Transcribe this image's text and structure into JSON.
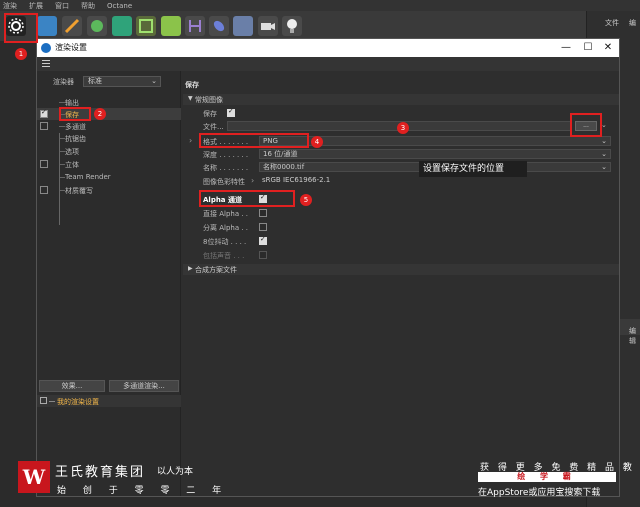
{
  "app_menu": [
    "渲染",
    "扩展",
    "窗口",
    "帮助",
    "Octane"
  ],
  "right_panel": {
    "file_label": "文件",
    "edit_label": "编",
    "edit_label2": "编辑"
  },
  "dialog": {
    "title": "渲染设置",
    "window_buttons": {
      "minimize": "—",
      "maximize": "☐",
      "close": "✕"
    }
  },
  "renderer": {
    "label": "渲染器",
    "value": "标准"
  },
  "tree_items": [
    {
      "label": "输出",
      "checkbox": "none"
    },
    {
      "label": "保存",
      "checkbox": "on",
      "active": true
    },
    {
      "label": "多通道",
      "checkbox": "off"
    },
    {
      "label": "抗锯齿",
      "checkbox": "none"
    },
    {
      "label": "选项",
      "checkbox": "none"
    },
    {
      "label": "立体",
      "checkbox": "off"
    },
    {
      "label": "Team Render",
      "checkbox": "none"
    },
    {
      "label": "材质覆写",
      "checkbox": "off"
    }
  ],
  "left_buttons": {
    "effects": "效果...",
    "multipass_render": "多通道渲染..."
  },
  "my_settings": "我的渲染设置",
  "main": {
    "section_title": "保存",
    "group_general": "常规图像",
    "save_label": "保存",
    "file_label": "文件...",
    "browse_label": "...",
    "format_label": "格式 . . . . . . .",
    "format_value": "PNG",
    "depth_label": "深度 . . . . . . .",
    "depth_value": "16 位/通道",
    "name_label": "名称 . . . . . . .",
    "name_value": "名称0000.tif",
    "color_profile_label": "图像色彩特性",
    "color_profile_value": "sRGB IEC61966-2.1",
    "alpha_label": "Alpha 通道",
    "straight_alpha_label": "直接 Alpha . .",
    "separate_alpha_label": "分离 Alpha . .",
    "dither_label": "8位抖动 . . . .",
    "include_sound_label": "包括声音 . . .",
    "group_compositing": "合成方案文件",
    "tooltip": "设置保存文件的位置"
  },
  "badges": [
    "1",
    "2",
    "3",
    "4",
    "5"
  ],
  "watermark": {
    "logo_letter": "W",
    "company": "王氏教育集团",
    "motto": "以人为本",
    "slogan": "始 创 于 零 零 二 年",
    "right_line1": "获 得 更 多 免 费 精 品 教 程",
    "right_line2": "绘 学 霸",
    "right_line3": "在AppStore或应用宝搜索下载"
  },
  "colors": {
    "annotation": "#e02020",
    "active_text": "#f5b94b",
    "brand": "#c8161d"
  }
}
